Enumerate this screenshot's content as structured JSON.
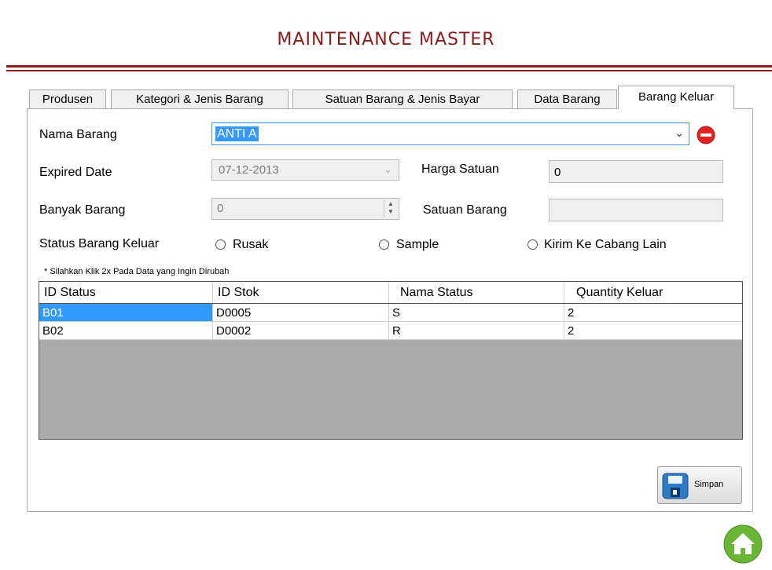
{
  "header": {
    "title": "MAINTENANCE MASTER"
  },
  "tabs": [
    {
      "label": "Produsen"
    },
    {
      "label": "Kategori & Jenis Barang"
    },
    {
      "label": "Satuan Barang & Jenis Bayar"
    },
    {
      "label": "Data Barang"
    },
    {
      "label": "Barang Keluar",
      "active": true
    }
  ],
  "form": {
    "nama_barang_label": "Nama Barang",
    "nama_barang_value": "ANTI A",
    "expired_label": "Expired Date",
    "expired_value": "07-12-2013",
    "harga_label": "Harga Satuan",
    "harga_value": "0",
    "banyak_label": "Banyak Barang",
    "banyak_value": "0",
    "satuan_label": "Satuan Barang",
    "satuan_value": "",
    "status_label": "Status Barang Keluar",
    "options": [
      "Rusak",
      "Sample",
      "Kirim Ke Cabang Lain"
    ]
  },
  "hint": "* Silahkan Klik 2x Pada Data yang Ingin Dirubah",
  "table": {
    "columns": [
      "ID Status",
      "ID Stok",
      "Nama Status",
      "Quantity Keluar"
    ],
    "rows": [
      [
        "B01",
        "D0005",
        "S",
        "2"
      ],
      [
        "B02",
        "D0002",
        "R",
        "2"
      ]
    ]
  },
  "buttons": {
    "save_label": "Simpan"
  },
  "colors": {
    "accent": "#8b1a1a",
    "selection": "#3399ff",
    "delete": "#e52222",
    "home": "#6ab536"
  },
  "icons": [
    "delete-icon",
    "floppy-disk-icon",
    "home-icon",
    "chevron-down-icon",
    "spinner-arrows-icon"
  ]
}
